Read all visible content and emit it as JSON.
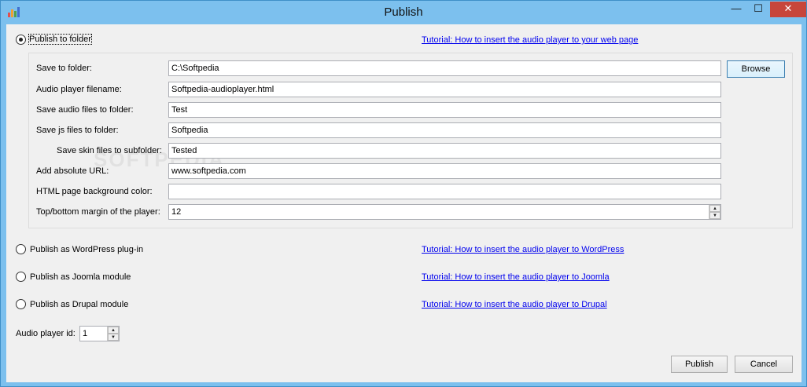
{
  "window": {
    "title": "Publish",
    "min_glyph": "—",
    "max_glyph": "☐",
    "close_glyph": "✕"
  },
  "folder_option": {
    "label": "Publish to folder",
    "selected": true,
    "tutorial": "Tutorial: How to insert the audio player to your web page"
  },
  "fields": {
    "save_to_folder": {
      "label": "Save to folder:",
      "value": "C:\\Softpedia"
    },
    "player_filename": {
      "label": "Audio player filename:",
      "value": "Softpedia-audioplayer.html"
    },
    "audio_folder": {
      "label": "Save audio files to folder:",
      "value": "Test"
    },
    "js_folder": {
      "label": "Save js files to folder:",
      "value": "Softpedia"
    },
    "skin_subfolder": {
      "label": "Save skin files to subfolder:",
      "value": "Tested"
    },
    "absolute_url": {
      "label": "Add absolute URL:",
      "value": "www.softpedia.com"
    },
    "bg_color": {
      "label": "HTML page background color:",
      "value": ""
    },
    "margin": {
      "label": "Top/bottom margin of the player:",
      "value": "12"
    }
  },
  "browse_label": "Browse",
  "wordpress_option": {
    "label": "Publish as WordPress plug-in",
    "tutorial": "Tutorial: How to insert the audio player to WordPress"
  },
  "joomla_option": {
    "label": "Publish as Joomla module",
    "tutorial": "Tutorial: How to insert the audio player to Joomla"
  },
  "drupal_option": {
    "label": "Publish as Drupal module",
    "tutorial": "Tutorial: How to insert the audio player to Drupal"
  },
  "player_id": {
    "label": "Audio player id:",
    "value": "1"
  },
  "buttons": {
    "publish": "Publish",
    "cancel": "Cancel"
  },
  "colors": {
    "titlebar": "#7cc0ee",
    "client": "#f0f0f0",
    "close": "#c7463b",
    "link": "#0000ee"
  }
}
